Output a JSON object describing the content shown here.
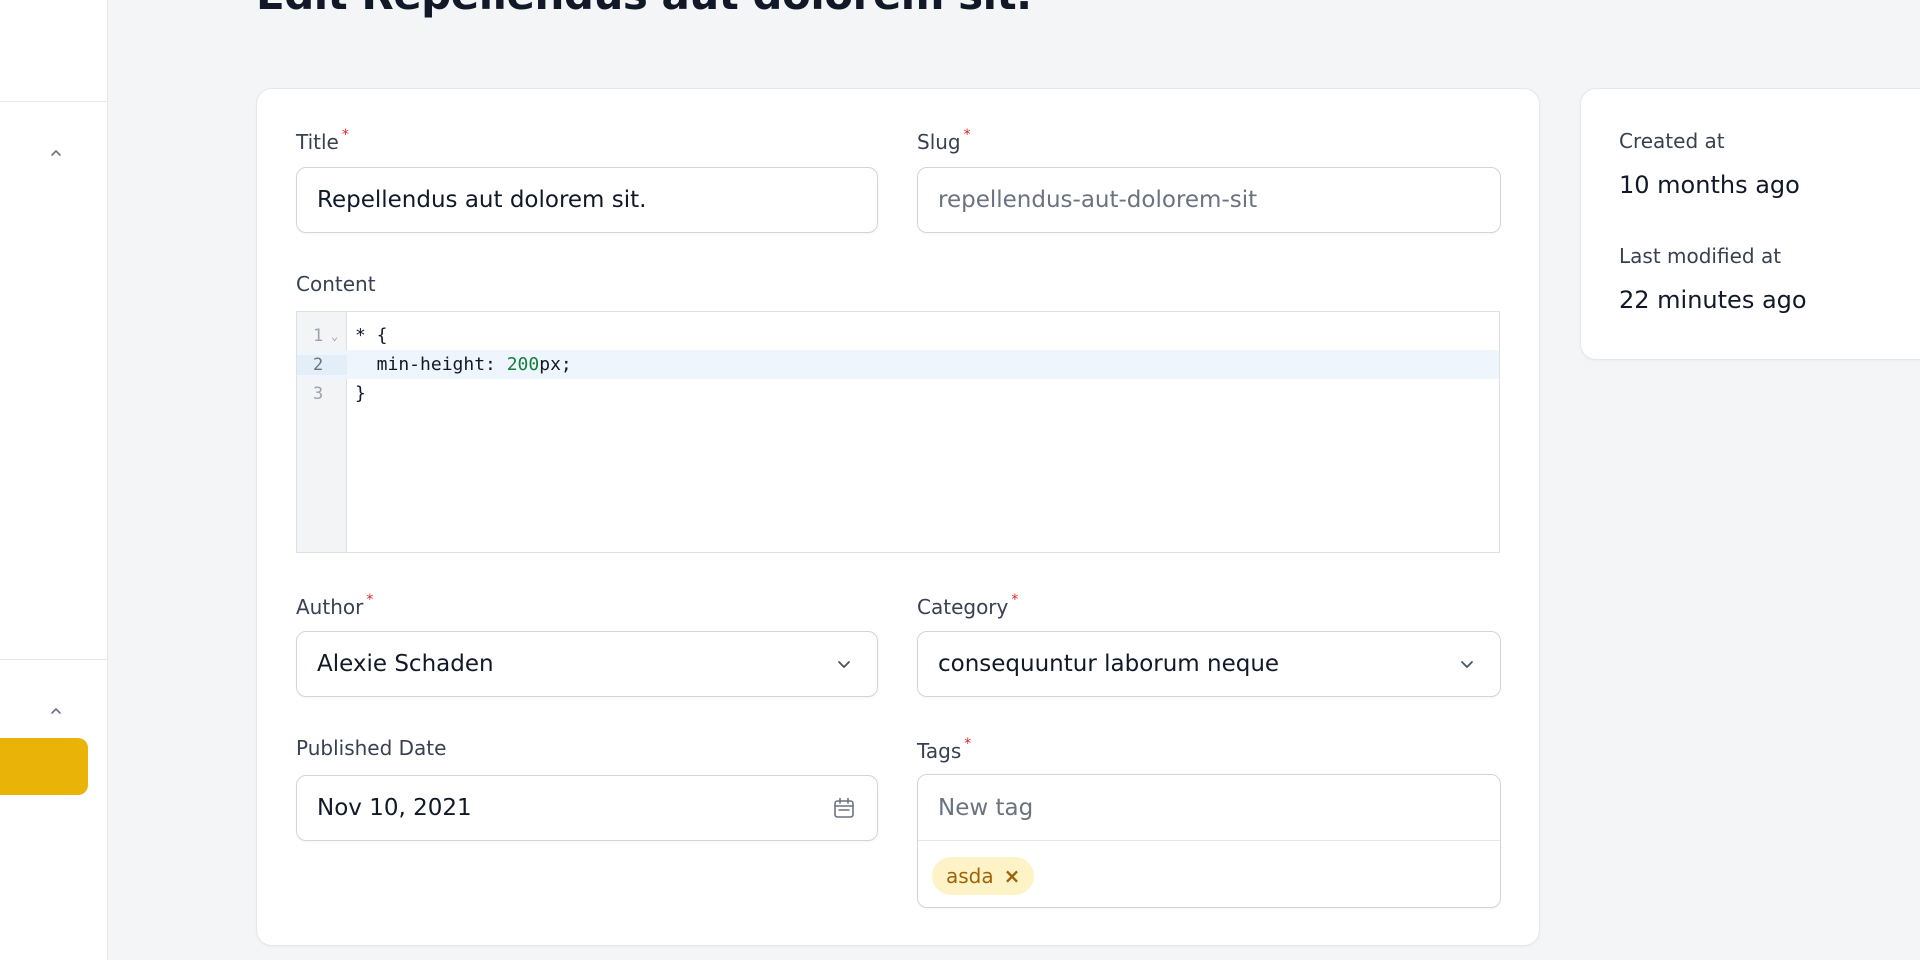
{
  "page": {
    "title": "Edit Repellendus aut dolorem sit."
  },
  "form": {
    "title": {
      "label": "Title",
      "required_mark": "*",
      "value": "Repellendus aut dolorem sit."
    },
    "slug": {
      "label": "Slug",
      "required_mark": "*",
      "value": "repellendus-aut-dolorem-sit"
    },
    "content": {
      "label": "Content",
      "lines": [
        {
          "num": "1",
          "code": "* {"
        },
        {
          "num": "2",
          "code_prefix": "  min-height: ",
          "code_number": "200",
          "code_suffix": "px;"
        },
        {
          "num": "3",
          "code": "}"
        }
      ]
    },
    "author": {
      "label": "Author",
      "required_mark": "*",
      "value": "Alexie Schaden"
    },
    "category": {
      "label": "Category",
      "required_mark": "*",
      "value": "consequuntur laborum neque"
    },
    "published_date": {
      "label": "Published Date",
      "value": "Nov 10, 2021"
    },
    "tags": {
      "label": "Tags",
      "required_mark": "*",
      "placeholder": "New tag",
      "items": [
        "asda"
      ],
      "remove_glyph": "×"
    }
  },
  "meta": {
    "created_label": "Created at",
    "created_value": "10 months ago",
    "modified_label": "Last modified at",
    "modified_value": "22 minutes ago"
  },
  "icons": {
    "chevron_down": "chevron-down-icon",
    "calendar": "calendar-icon",
    "chevron_up": "chevron-up-icon"
  },
  "colors": {
    "accent": "#eab308",
    "required": "#dc2626",
    "tag_bg": "#fef3c7",
    "tag_text": "#a16207"
  }
}
